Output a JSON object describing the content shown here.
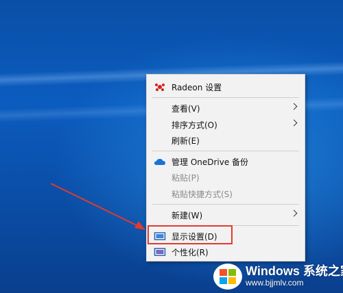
{
  "menu": {
    "radeon": "Radeon 设置",
    "view": "查看(V)",
    "sort": "排序方式(O)",
    "refresh": "刷新(E)",
    "onedrive": "管理 OneDrive 备份",
    "paste": "粘贴(P)",
    "paste_shortcut": "粘贴快捷方式(S)",
    "new": "新建(W)",
    "display": "显示设置(D)",
    "personalize": "个性化(R)"
  },
  "watermark": {
    "title": "Windows 系统之家",
    "url": "www.bjjmlv.com"
  },
  "colors": {
    "desktop_blue": "#0b5cbf",
    "menu_bg": "#f2f2f2",
    "highlight_red": "#e23a2e"
  }
}
